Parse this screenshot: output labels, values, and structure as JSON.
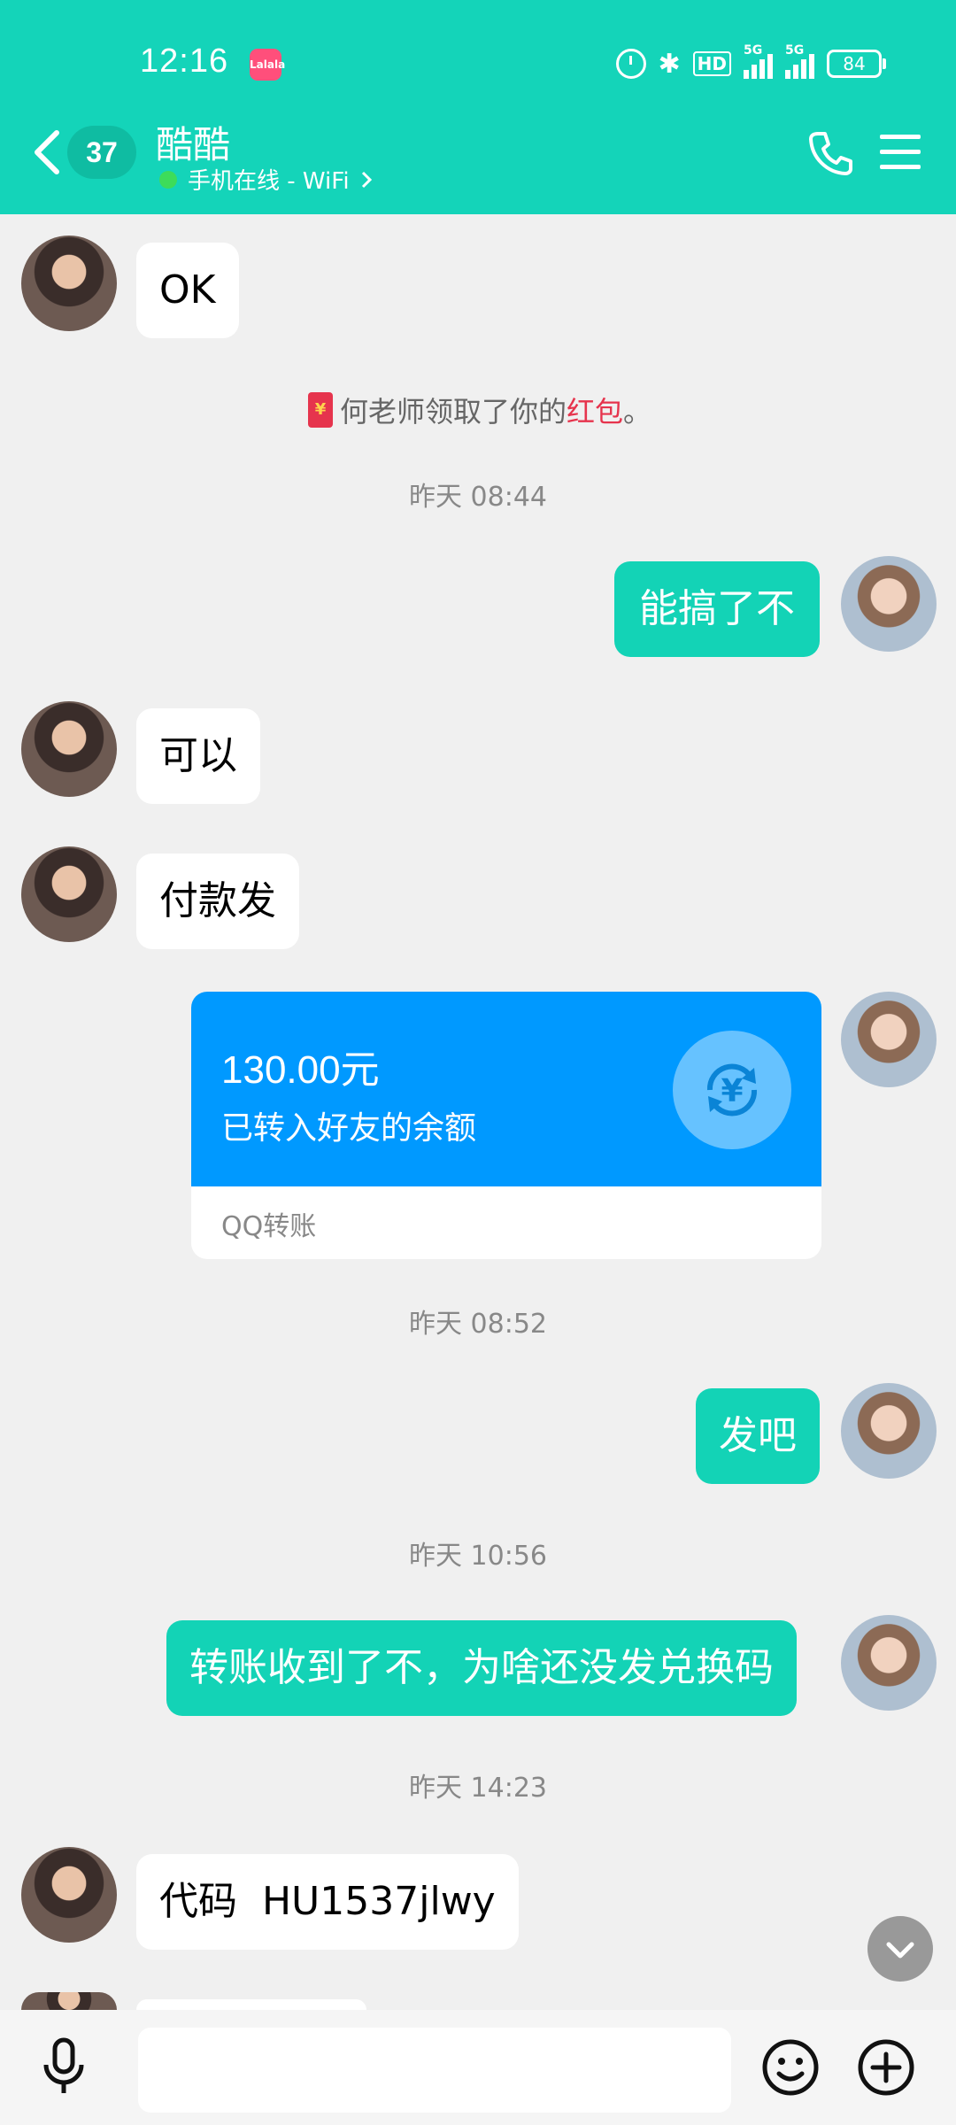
{
  "status_bar": {
    "time": "12:16",
    "app_icon_text": "Lalala",
    "hd_label": "HD",
    "network_1": "5G",
    "network_2": "5G",
    "battery": "84"
  },
  "header": {
    "unread_count": "37",
    "title": "酷酷",
    "subtitle": "手机在线 - WiFi",
    "accent_color": "#14d4b9"
  },
  "messages": [
    {
      "side": "left",
      "text": "OK"
    },
    {
      "type": "system",
      "pre": "何老师领取了你的",
      "link": "红包",
      "post": "。"
    },
    {
      "type": "time",
      "text": "昨天 08:44"
    },
    {
      "side": "right",
      "text": "能搞了不"
    },
    {
      "side": "left",
      "text": "可以"
    },
    {
      "side": "left",
      "text": "付款发"
    },
    {
      "type": "transfer",
      "amount": "130.00元",
      "desc": "已转入好友的余额",
      "label": "QQ转账",
      "color": "#0099ff"
    },
    {
      "type": "time",
      "text": "昨天 08:52"
    },
    {
      "side": "right",
      "text": "发吧"
    },
    {
      "type": "time",
      "text": "昨天 10:56"
    },
    {
      "side": "right",
      "text": "转账收到了不，为啥还没发兑换码"
    },
    {
      "type": "time",
      "text": "昨天 14:23"
    },
    {
      "side": "left",
      "text": "代码  HU1537jlwy"
    }
  ],
  "input": {
    "placeholder": ""
  }
}
